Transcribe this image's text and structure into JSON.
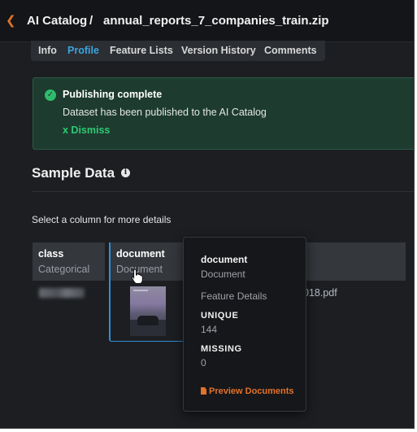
{
  "header": {
    "root": "AI Catalog",
    "separator": "/",
    "filename": "annual_reports_7_companies_train.zip"
  },
  "tabs": [
    {
      "label": "Info",
      "active": false
    },
    {
      "label": "Profile",
      "active": true
    },
    {
      "label": "Feature Lists",
      "active": false
    },
    {
      "label": "Version History",
      "active": false
    },
    {
      "label": "Comments",
      "active": false
    }
  ],
  "alert": {
    "title": "Publishing complete",
    "message": "Dataset has been published to the AI Catalog",
    "dismiss": "x Dismiss",
    "color": "#2ebd6b"
  },
  "sample": {
    "title": "Sample Data",
    "hint": "Select a column for more details",
    "columns": [
      {
        "name": "class",
        "type": "Categorical"
      },
      {
        "name": "document",
        "type": "Document"
      }
    ],
    "partial_cell": "018.pdf"
  },
  "popover": {
    "title": "document",
    "type": "Document",
    "section": "Feature Details",
    "unique_label": "UNIQUE",
    "unique_value": "144",
    "missing_label": "MISSING",
    "missing_value": "0",
    "link": "Preview Documents"
  },
  "colors": {
    "accent_orange": "#e2722a",
    "active_tab": "#3ba5e0",
    "selected_border": "#2f8fd4"
  }
}
